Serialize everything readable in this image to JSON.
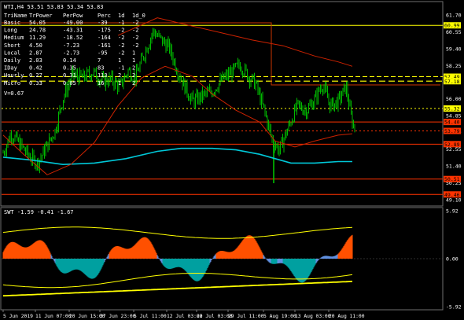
{
  "main_chart": {
    "header": "WTI,H4  53.51 53.83 53.34 53.83",
    "table": {
      "columns": [
        "TriName",
        "TrPower",
        "PerPow",
        "Perc",
        "1d",
        "1d_0"
      ],
      "rows": [
        [
          "Basic",
          "54.05",
          "-49.00",
          "-39",
          "-1",
          "-2"
        ],
        [
          "Long",
          "24.78",
          "-43.31",
          "-175",
          "-2",
          "-2"
        ],
        [
          "Medium",
          "11.29",
          "-18.52",
          "-164",
          "-2",
          "-2"
        ],
        [
          "Short",
          "4.50",
          "-7.23",
          "-161",
          "-2",
          "-2"
        ],
        [
          "Local",
          "2.87",
          "-2.73",
          "-95",
          "-2",
          "1"
        ],
        [
          "Daily",
          "2.03",
          "0.14",
          "7",
          "1",
          "1"
        ],
        [
          "IDay",
          "0.42",
          "0.35",
          "83",
          "-1",
          "2"
        ],
        [
          "Hourly",
          "0.27",
          "0.31",
          "113",
          "2",
          "2"
        ],
        [
          "Micro",
          "0.33",
          "0.05",
          "16",
          "1",
          "2"
        ]
      ],
      "footer": "V=0.67"
    },
    "price_axis": [
      "61.70",
      "60.55",
      "59.40",
      "58.25",
      "56.00",
      "54.85",
      "53.70",
      "52.55",
      "51.40",
      "50.25",
      "49.10"
    ],
    "price_tags": [
      {
        "value": "60.99",
        "color": "#ffff00"
      },
      {
        "value": "57.49",
        "color": "#ffff00"
      },
      {
        "value": "57.18",
        "color": "#ffff00"
      },
      {
        "value": "55.32",
        "color": "#ffff00"
      },
      {
        "value": "54.40",
        "color": "#ff3300"
      },
      {
        "value": "53.79",
        "color": "#ff3300"
      },
      {
        "value": "52.89",
        "color": "#ff3300"
      },
      {
        "value": "50.51",
        "color": "#ff3300"
      },
      {
        "value": "49.46",
        "color": "#ff3300"
      }
    ]
  },
  "sub_chart": {
    "header": "SWT -1.59 -0.41 -1.67",
    "axis": [
      "5.92",
      "0.00",
      "-5.92"
    ]
  },
  "time_axis": [
    "5 Jun 2019",
    "11 Jun 07:00",
    "20 Jun 15:00",
    "27 Jun 23:00",
    "5 Jul 11:00",
    "12 Jul 03:00",
    "22 Jul 03:00",
    "29 Jul 11:00",
    "5 Aug 19:00",
    "13 Aug 03:00",
    "20 Aug 11:00"
  ],
  "colors": {
    "background": "#000000",
    "candles": "#00cc00",
    "grid_border": "#808080",
    "ma_cyan": "#00c8d8",
    "ma_red": "#cc2200",
    "histogram_orange": "#ff5000",
    "histogram_blue": "#6090e0",
    "histogram_teal": "#00a0a0",
    "envelope_yellow": "#ffff00"
  }
}
